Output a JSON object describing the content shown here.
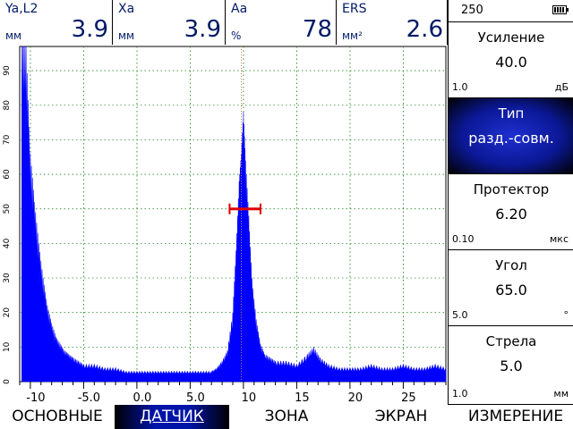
{
  "readouts": [
    {
      "label": "Ya,L2",
      "unit": "мм",
      "value": "3.9"
    },
    {
      "label": "Xa",
      "unit": "мм",
      "value": "3.9"
    },
    {
      "label": "Aa",
      "unit": "%",
      "value": "78"
    },
    {
      "label": "ERS",
      "unit": "мм²",
      "value": "2.6"
    }
  ],
  "battery": {
    "value": "250",
    "level": 1.0
  },
  "params": [
    {
      "title": "Усиление",
      "value": "40.0",
      "min": "1.0",
      "unit": "дБ",
      "active": false
    },
    {
      "title": "Тип",
      "value": "разд.-совм.",
      "min": "",
      "unit": "",
      "active": true
    },
    {
      "title": "Протектор",
      "value": "6.20",
      "min": "0.10",
      "unit": "мкс",
      "active": false
    },
    {
      "title": "Угол",
      "value": "65.0",
      "min": "5.0",
      "unit": "°",
      "active": false
    },
    {
      "title": "Стрела",
      "value": "5.0",
      "min": "1.0",
      "unit": "мм",
      "active": false
    }
  ],
  "tabs": [
    {
      "label": "ОСНОВНЫЕ",
      "active": false
    },
    {
      "label": "ДАТЧИК",
      "active": true
    },
    {
      "label": "ЗОНА",
      "active": false
    },
    {
      "label": "ЭКРАН",
      "active": false
    },
    {
      "label": "ИЗМЕРЕНИЕ",
      "active": false
    }
  ],
  "chart_data": {
    "type": "area",
    "x_ticks": [
      "-10",
      "-5.0",
      "0.0",
      "5.0",
      "10",
      "15",
      "20",
      "25"
    ],
    "y_ticks": [
      "0",
      "10",
      "20",
      "30",
      "40",
      "50",
      "60",
      "70",
      "80",
      "90"
    ],
    "xlim": [
      -11,
      29
    ],
    "ylim": [
      0,
      97
    ],
    "grid": true,
    "cursor_x": 9.8,
    "gate": {
      "start": 8.7,
      "end": 11.6,
      "level": 50
    },
    "colors": {
      "signal": "#0000ff",
      "gate": "#e00000",
      "grid": "#2a8a2a",
      "cursor": "#c08040"
    },
    "series": [
      {
        "x": [
          -10.8,
          -10.4,
          -10.0,
          -9.6,
          -9.2,
          -8.8,
          -8.4,
          -8.0,
          -7.6,
          -7.2,
          -6.8,
          -6.4,
          -6.0,
          -5.5,
          -5.0,
          -4.0,
          -3.0,
          -2.0,
          -1.0,
          0.0,
          1.0,
          2.0,
          3.0,
          4.0,
          5.0,
          6.0,
          7.0,
          7.5,
          8.0,
          8.5,
          9.0,
          9.3,
          9.6,
          9.8,
          10.0,
          10.2,
          10.5,
          10.8,
          11.2,
          11.6,
          12.0,
          12.5,
          13.0,
          14.0,
          15.0,
          16.0,
          16.6,
          17.2,
          18.0,
          19.0,
          20.0,
          21.0,
          22.0,
          23.0,
          24.0,
          25.0,
          26.0,
          27.0,
          28.0,
          29.0
        ],
        "y": [
          97,
          97,
          66,
          52,
          40,
          30,
          22,
          17,
          13,
          11,
          9,
          8,
          7,
          6,
          5,
          5,
          4,
          4,
          3,
          3,
          3,
          3,
          3,
          3,
          3,
          3,
          3,
          4,
          6,
          9,
          20,
          38,
          58,
          66,
          78,
          64,
          48,
          30,
          18,
          11,
          8,
          7,
          6,
          6,
          5,
          8,
          10,
          7,
          5,
          4,
          4,
          4,
          5,
          4,
          4,
          5,
          4,
          4,
          5,
          4
        ]
      }
    ]
  }
}
